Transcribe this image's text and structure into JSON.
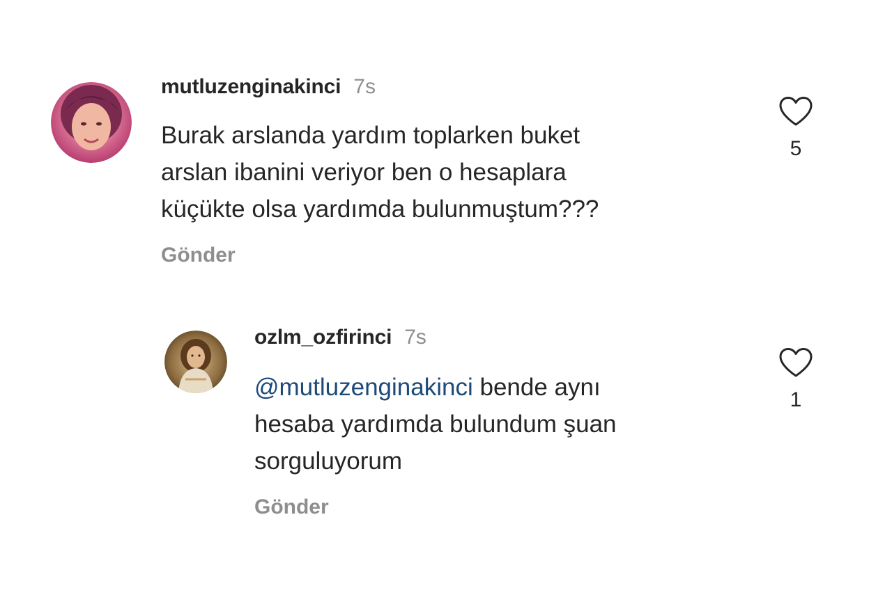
{
  "comments": [
    {
      "username": "mutluzenginakinci",
      "time": "7s",
      "lines": [
        "Burak arslanda yardım toplarken buket",
        "arslan ibanini veriyor ben o hesaplara",
        "küçükte olsa yardımda bulunmuştum???"
      ],
      "reply_label": "Gönder",
      "likes": "5",
      "like_icon": "heart-outline-icon"
    },
    {
      "username": "ozlm_ozfirinci",
      "time": "7s",
      "mention": "@mutluzenginakinci",
      "line1_rest": " bende aynı",
      "lines": [
        "hesaba yardımda bulundum şuan",
        "sorguluyorum"
      ],
      "reply_label": "Gönder",
      "likes": "1",
      "like_icon": "heart-outline-icon"
    }
  ],
  "colors": {
    "username": "#262626",
    "meta": "#8e8e8e",
    "mention": "#1d4a78",
    "avatar1_border": "#c0477f",
    "avatar2_border": "#6b4a2a"
  }
}
